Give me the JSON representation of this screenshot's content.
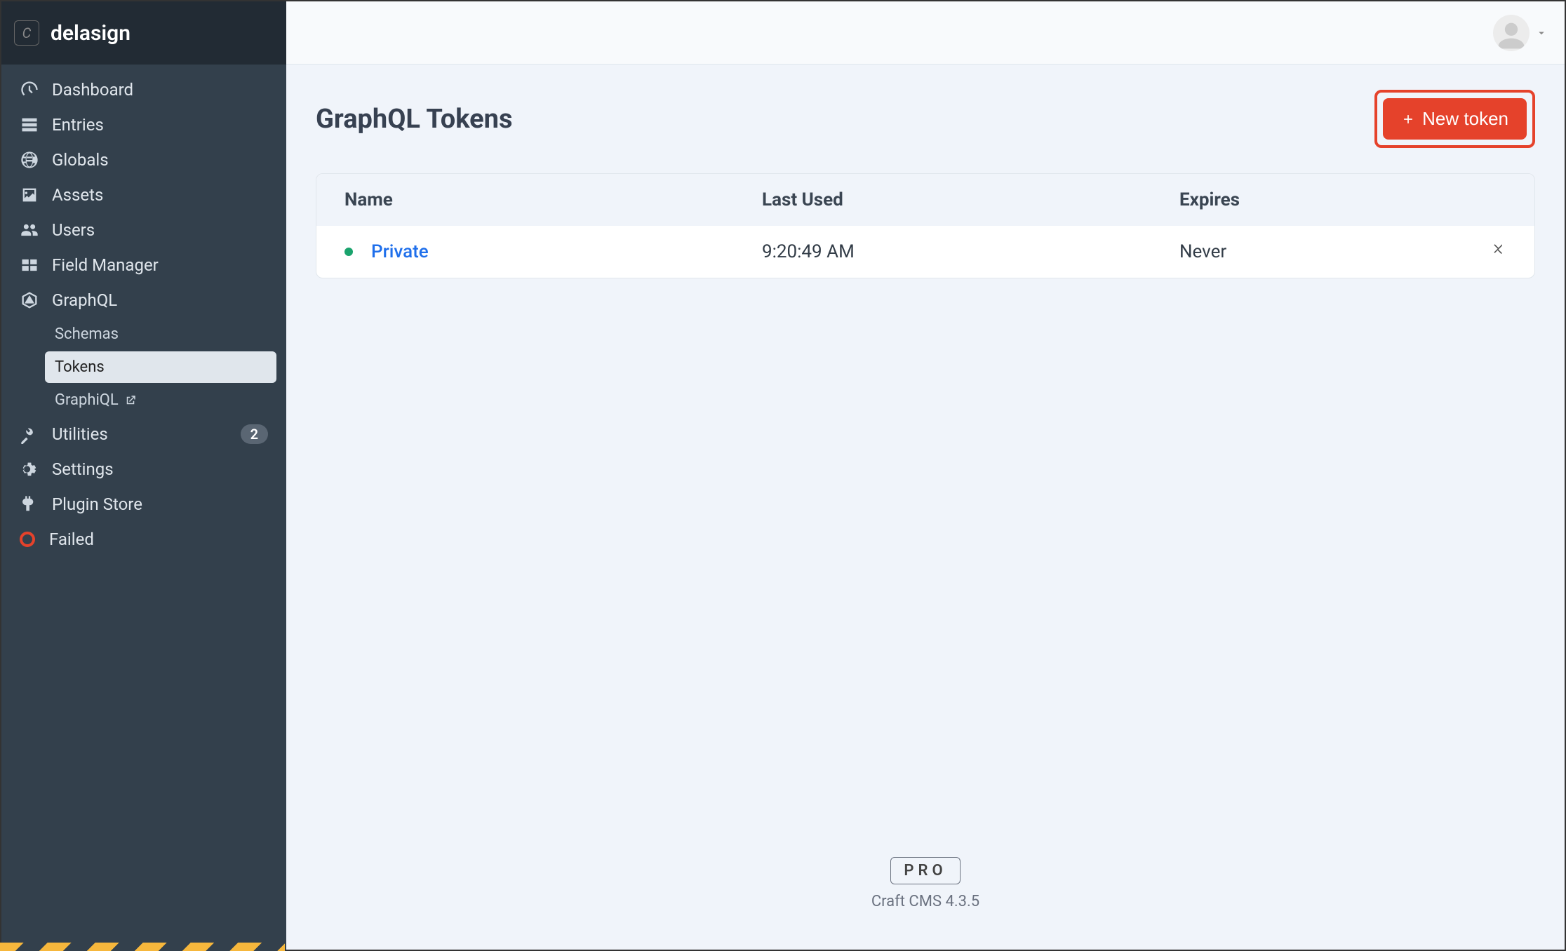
{
  "header": {
    "logo_letter": "C",
    "brand": "delasign"
  },
  "sidebar": {
    "items": [
      {
        "label": "Dashboard",
        "icon": "dashboard-icon"
      },
      {
        "label": "Entries",
        "icon": "entries-icon"
      },
      {
        "label": "Globals",
        "icon": "globals-icon"
      },
      {
        "label": "Assets",
        "icon": "assets-icon"
      },
      {
        "label": "Users",
        "icon": "users-icon"
      },
      {
        "label": "Field Manager",
        "icon": "field-manager-icon"
      },
      {
        "label": "GraphQL",
        "icon": "graphql-icon"
      },
      {
        "label": "Utilities",
        "icon": "utilities-icon",
        "badge": "2"
      },
      {
        "label": "Settings",
        "icon": "settings-icon"
      },
      {
        "label": "Plugin Store",
        "icon": "plugin-store-icon"
      },
      {
        "label": "Failed",
        "icon": "failed-icon"
      }
    ],
    "graphql_sub": [
      {
        "label": "Schemas",
        "active": false
      },
      {
        "label": "Tokens",
        "active": true
      },
      {
        "label": "GraphiQL",
        "active": false,
        "external": true
      }
    ]
  },
  "page": {
    "title": "GraphQL Tokens",
    "new_button": "New token"
  },
  "table": {
    "headers": {
      "name": "Name",
      "last_used": "Last Used",
      "expires": "Expires"
    },
    "rows": [
      {
        "name": "Private",
        "last_used": "9:20:49 AM",
        "expires": "Never",
        "status": "active"
      }
    ]
  },
  "footer": {
    "edition": "PRO",
    "version": "Craft CMS 4.3.5"
  }
}
